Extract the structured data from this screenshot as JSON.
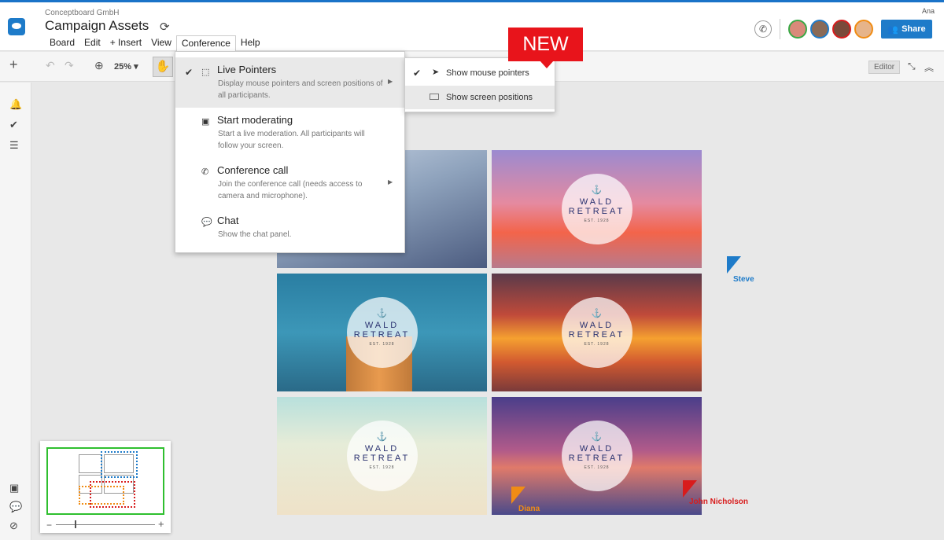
{
  "header": {
    "org": "Conceptboard GmbH",
    "title": "Campaign Assets",
    "user": "Ana",
    "share_label": "Share",
    "menus": [
      "Board",
      "Edit",
      "+ Insert",
      "View",
      "Conference",
      "Help"
    ],
    "active_menu": "Conference"
  },
  "toolbar": {
    "zoom": "25%",
    "editor_label": "Editor"
  },
  "conference_menu": {
    "items": [
      {
        "label": "Live Pointers",
        "desc": "Display mouse pointers and screen positions of all participants.",
        "checked": true,
        "has_submenu": true
      },
      {
        "label": "Start moderating",
        "desc": "Start a live moderation. All participants will follow your screen.",
        "checked": false,
        "has_submenu": false
      },
      {
        "label": "Conference call",
        "desc": "Join the conference call (needs access to camera and microphone).",
        "checked": false,
        "has_submenu": true
      },
      {
        "label": "Chat",
        "desc": "Show the chat panel.",
        "checked": false,
        "has_submenu": false
      }
    ]
  },
  "submenu": {
    "items": [
      {
        "label": "Show mouse pointers",
        "checked": true
      },
      {
        "label": "Show screen positions",
        "checked": false
      }
    ],
    "new_badge": "NEW"
  },
  "board": {
    "badge_line1": "WALD",
    "badge_line2": "RETREAT",
    "badge_est": "EST. 1928"
  },
  "pointers": [
    {
      "name": "Steve",
      "color": "#1e7bc9"
    },
    {
      "name": "Diana",
      "color": "#f08c14"
    },
    {
      "name": "John Nicholson",
      "color": "#d81c1c"
    }
  ],
  "colors": {
    "accent": "#1e7bc9",
    "new_badge": "#e8141b"
  }
}
